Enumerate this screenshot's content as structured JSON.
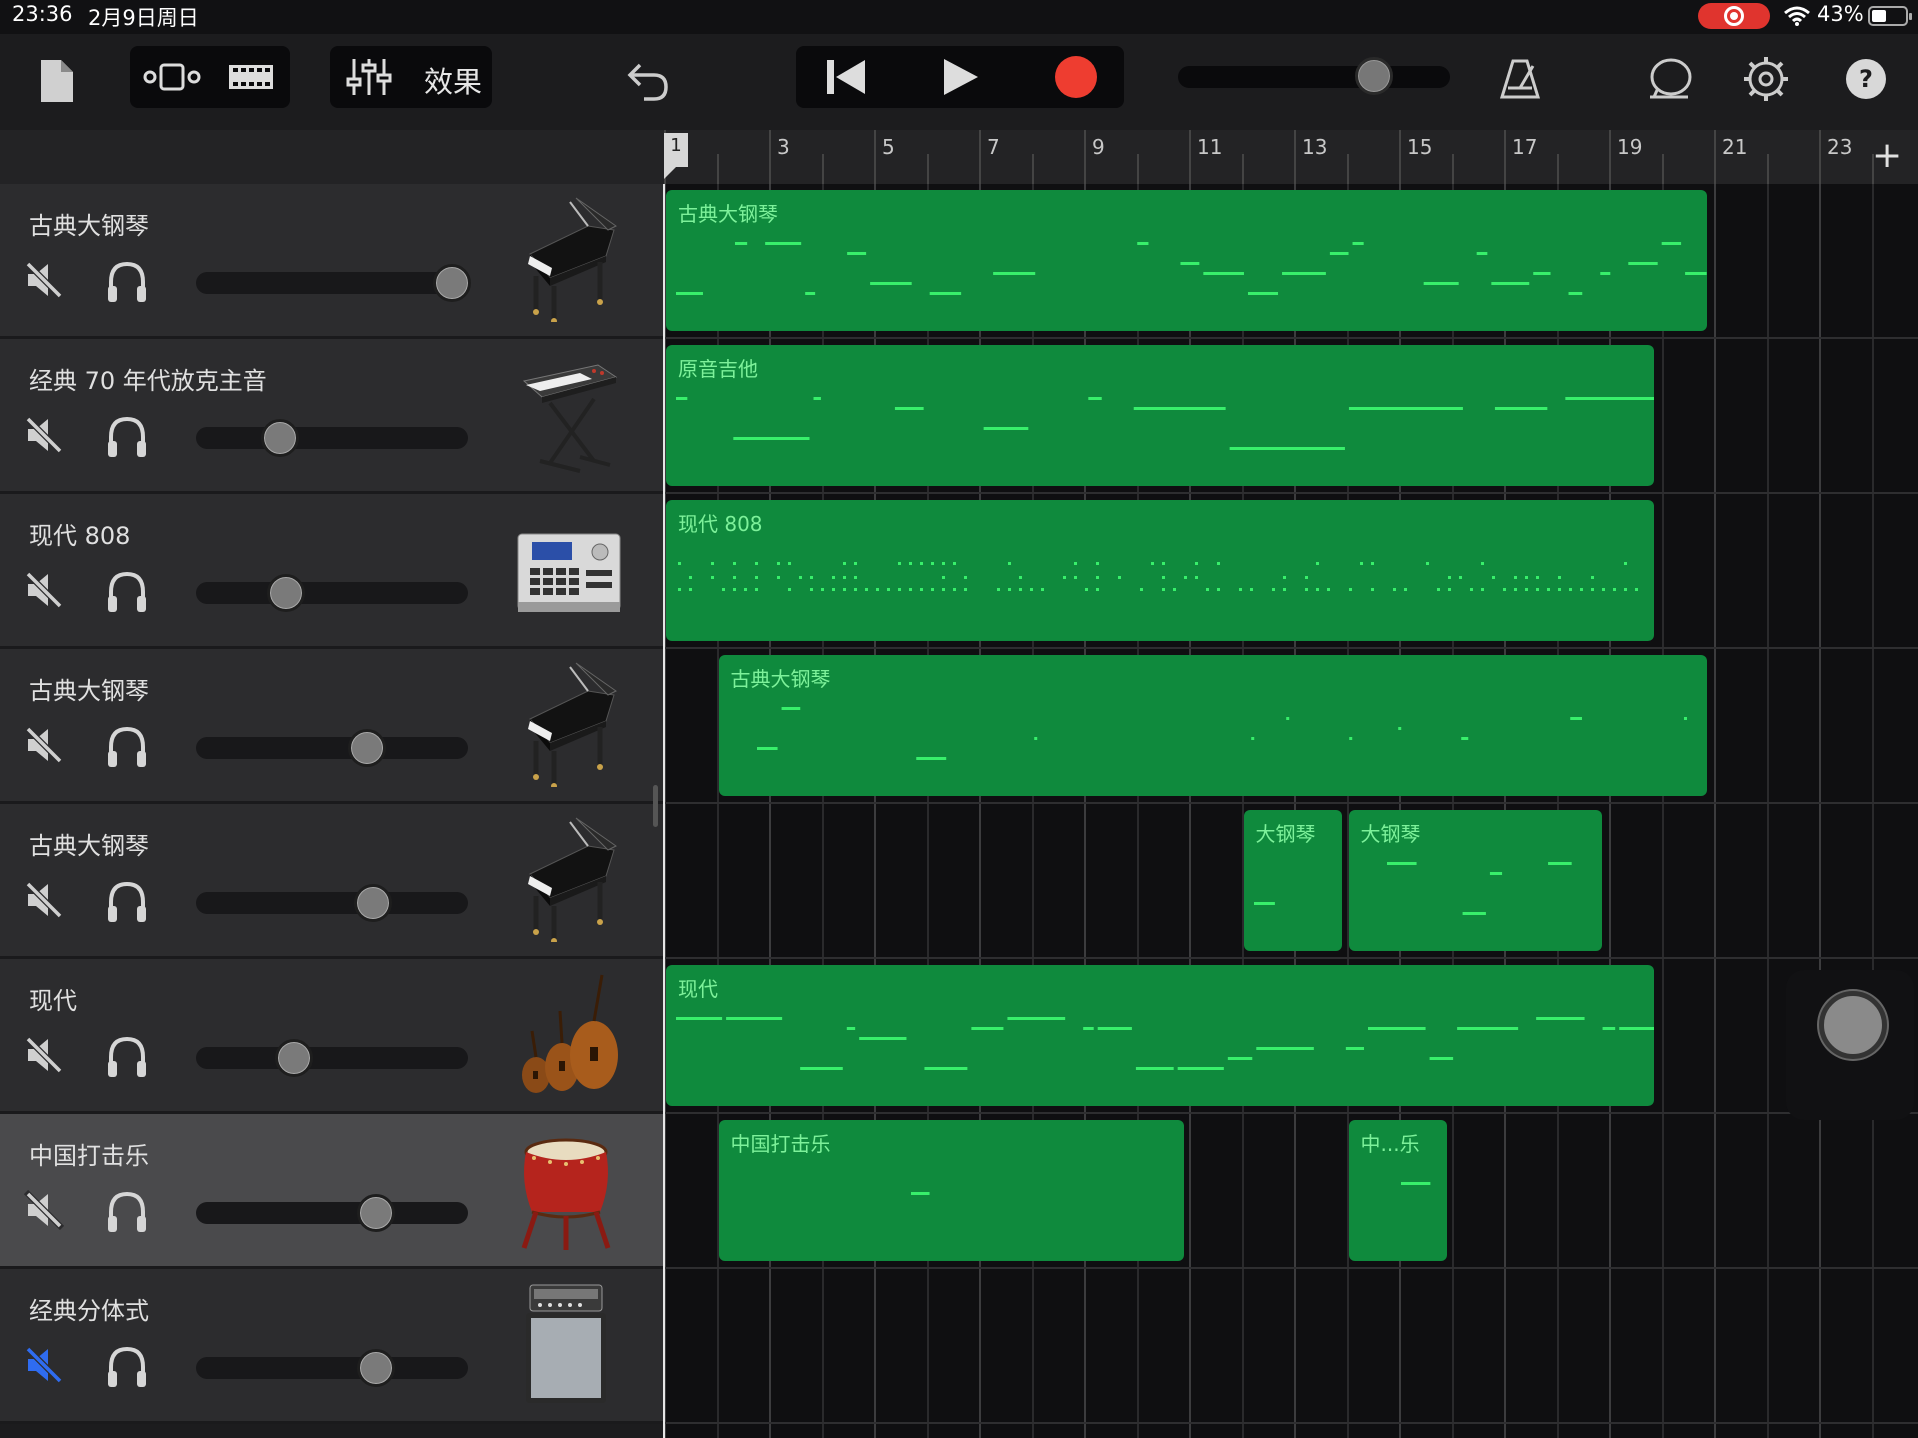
{
  "status_bar": {
    "time": "23:36",
    "date": "2月9日周日",
    "battery": "43%"
  },
  "toolbar": {
    "effects_label": "效果",
    "icons": [
      "document-icon",
      "tracks-view-icon",
      "loop-browser-icon",
      "mixer-icon",
      "undo-icon",
      "rewind-icon",
      "play-icon",
      "record-icon",
      "metronome-icon",
      "chat-icon",
      "settings-icon",
      "help-icon"
    ],
    "accent_record": "#ee3d30"
  },
  "ruler": {
    "numbers": [
      "1",
      "3",
      "5",
      "7",
      "9",
      "11",
      "13",
      "15",
      "17",
      "19",
      "21",
      "23"
    ],
    "add_label": "+"
  },
  "tracks": [
    {
      "name": "古典大钢琴",
      "instrument": "grand-piano",
      "volume": 0.94,
      "muted": true,
      "mute_color": "#cfcfcf",
      "selected": false
    },
    {
      "name": "经典 70 年代放克主音",
      "instrument": "synth-keyboard",
      "volume": 0.31,
      "muted": true,
      "mute_color": "#cfcfcf",
      "selected": false
    },
    {
      "name": "现代 808",
      "instrument": "drum-machine",
      "volume": 0.33,
      "muted": true,
      "mute_color": "#cfcfcf",
      "selected": false
    },
    {
      "name": "古典大钢琴",
      "instrument": "grand-piano",
      "volume": 0.63,
      "muted": true,
      "mute_color": "#cfcfcf",
      "selected": false
    },
    {
      "name": "古典大钢琴",
      "instrument": "grand-piano",
      "volume": 0.65,
      "muted": true,
      "mute_color": "#cfcfcf",
      "selected": false
    },
    {
      "name": "现代",
      "instrument": "strings",
      "volume": 0.36,
      "muted": true,
      "mute_color": "#cfcfcf",
      "selected": false
    },
    {
      "name": "中国打击乐",
      "instrument": "chinese-drum",
      "volume": 0.66,
      "muted": true,
      "mute_color": "#cfcfcf",
      "selected": true
    },
    {
      "name": "经典分体式",
      "instrument": "amp-cabinet",
      "volume": 0.66,
      "muted": true,
      "mute_color": "#2f6cf0",
      "selected": false
    }
  ],
  "regions": [
    {
      "track": 0,
      "name": "古典大钢琴",
      "start": 1.0,
      "end": 20.9,
      "pattern": "melodic"
    },
    {
      "track": 1,
      "name": "原音吉他",
      "start": 1.0,
      "end": 19.9,
      "pattern": "long"
    },
    {
      "track": 2,
      "name": "现代 808",
      "start": 1.0,
      "end": 19.9,
      "pattern": "drums"
    },
    {
      "track": 3,
      "name": "古典大钢琴",
      "start": 2.0,
      "end": 20.9,
      "pattern": "sparse"
    },
    {
      "track": 4,
      "name": "大钢琴",
      "start": 12.0,
      "end": 13.95,
      "pattern": "short"
    },
    {
      "track": 4,
      "name": "大钢琴",
      "start": 14.0,
      "end": 18.9,
      "pattern": "short"
    },
    {
      "track": 5,
      "name": "现代",
      "start": 1.0,
      "end": 19.9,
      "pattern": "dense"
    },
    {
      "track": 6,
      "name": "中国打击乐",
      "start": 2.0,
      "end": 10.95,
      "pattern": "perc"
    },
    {
      "track": 6,
      "name": "中...乐",
      "start": 14.0,
      "end": 15.95,
      "pattern": "perc-short"
    }
  ],
  "colors": {
    "region": "#0f8a3d",
    "note": "#38ef6b",
    "region_text": "#7df19a",
    "record": "#ee3d30"
  }
}
